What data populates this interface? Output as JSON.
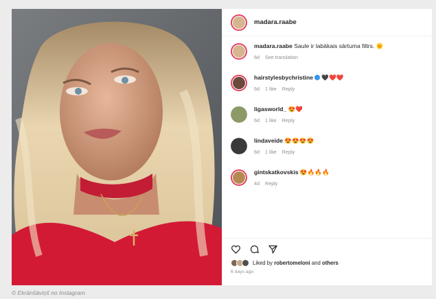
{
  "post": {
    "username": "madara.raabe"
  },
  "comments": [
    {
      "user": "madara.raabe",
      "text": "Saule ir labākais sārtuma filtrs. 🌞",
      "age": "6d",
      "likes": "",
      "reply": "",
      "translate": "See translation"
    },
    {
      "user": "hairstylesbychristine",
      "text": "🖤❤️❤️",
      "age": "6d",
      "likes": "1 like",
      "reply": "Reply",
      "translate": ""
    },
    {
      "user": "ligasworld_",
      "text": "😍❤️",
      "age": "6d",
      "likes": "1 like",
      "reply": "Reply",
      "translate": ""
    },
    {
      "user": "lindaveide",
      "text": "😍😍😍😍",
      "age": "6d",
      "likes": "1 like",
      "reply": "Reply",
      "translate": ""
    },
    {
      "user": "gintskatkovskis",
      "text": "😍🔥🔥🔥",
      "age": "4d",
      "likes": "",
      "reply": "Reply",
      "translate": ""
    }
  ],
  "footer": {
    "liked_prefix": "Liked by",
    "liked_user": "robertomeloni",
    "liked_and": "and",
    "liked_others": "others",
    "time": "6 days ago"
  },
  "caption": "© Ekrānšāviņš no Instagram",
  "icons": [
    "heart-icon",
    "comment-icon",
    "share-icon",
    "verified-icon"
  ],
  "colors": {
    "story_ring": "#e4405f",
    "verified": "#3897f0",
    "muted": "#8e8e8e",
    "text": "#262626"
  }
}
